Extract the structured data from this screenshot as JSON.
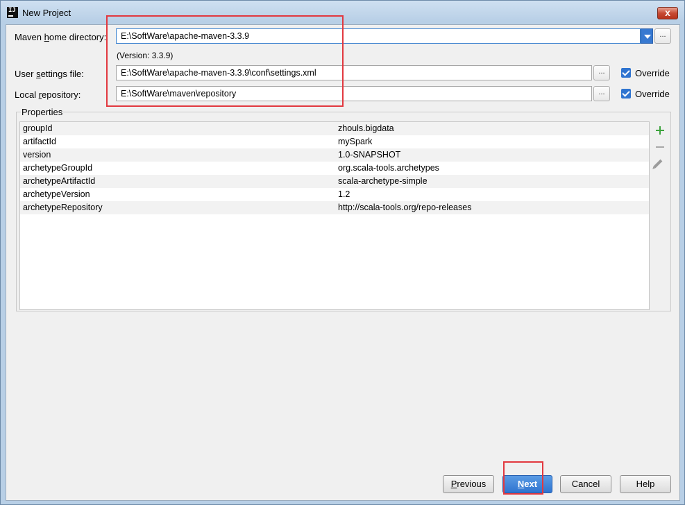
{
  "window": {
    "title": "New Project",
    "app_icon_text": "IJ",
    "close_label": "x"
  },
  "form": {
    "maven_home": {
      "label_pre": "Maven ",
      "label_mn": "h",
      "label_post": "ome directory:",
      "value": "E:\\SoftWare\\apache-maven-3.3.9",
      "version": "(Version: 3.3.9)"
    },
    "user_settings": {
      "label_pre": "User ",
      "label_mn": "s",
      "label_post": "ettings file:",
      "value": "E:\\SoftWare\\apache-maven-3.3.9\\conf\\settings.xml",
      "override_label": "Override",
      "override_checked": true
    },
    "local_repo": {
      "label_pre": "Local ",
      "label_mn": "r",
      "label_post": "epository:",
      "value": "E:\\SoftWare\\maven\\repository",
      "override_label": "Override",
      "override_checked": true
    },
    "browse_label": "..."
  },
  "properties": {
    "title": "Properties",
    "rows": [
      {
        "key": "groupId",
        "value": "zhouls.bigdata"
      },
      {
        "key": "artifactId",
        "value": "mySpark"
      },
      {
        "key": "version",
        "value": "1.0-SNAPSHOT"
      },
      {
        "key": "archetypeGroupId",
        "value": "org.scala-tools.archetypes"
      },
      {
        "key": "archetypeArtifactId",
        "value": "scala-archetype-simple"
      },
      {
        "key": "archetypeVersion",
        "value": "1.2"
      },
      {
        "key": "archetypeRepository",
        "value": "http://scala-tools.org/repo-releases"
      }
    ]
  },
  "buttons": {
    "previous": {
      "mn": "P",
      "rest": "revious"
    },
    "next": {
      "mn": "N",
      "rest": "ext"
    },
    "cancel": "Cancel",
    "help": "Help"
  },
  "colors": {
    "highlight_box": "#e2383f",
    "primary_button": "#2f74d0",
    "add_icon": "#3da33d"
  }
}
